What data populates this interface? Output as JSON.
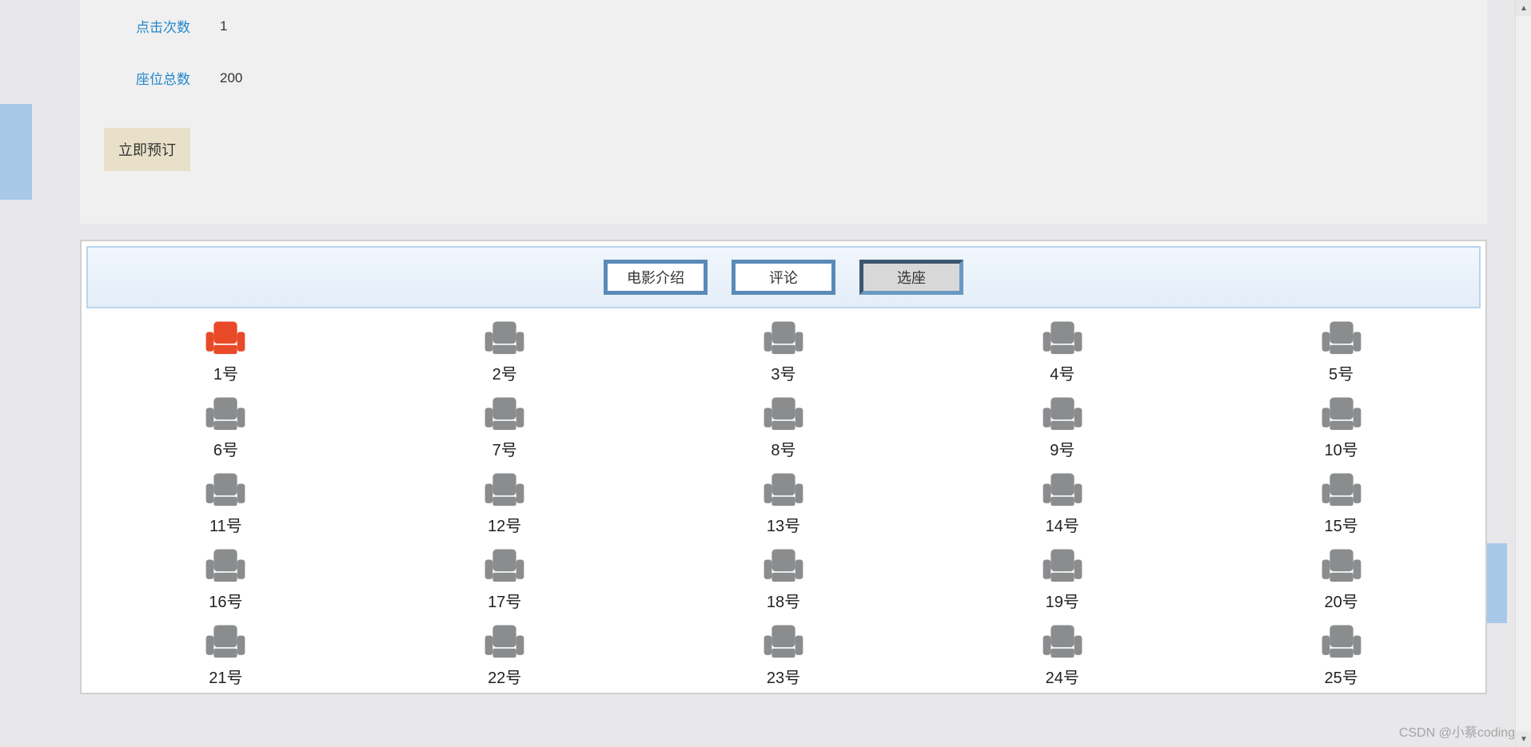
{
  "info": {
    "click_count_label": "点击次数",
    "click_count_value": "1",
    "seat_total_label": "座位总数",
    "seat_total_value": "200"
  },
  "actions": {
    "book_now": "立即预订"
  },
  "tabs": [
    {
      "label": "电影介绍",
      "active": false
    },
    {
      "label": "评论",
      "active": false
    },
    {
      "label": "选座",
      "active": true
    }
  ],
  "seats": {
    "columns": 5,
    "selected_color": "#e84a28",
    "available_color": "#8a8c8e",
    "items": [
      {
        "number": 1,
        "label": "1号",
        "selected": true
      },
      {
        "number": 2,
        "label": "2号",
        "selected": false
      },
      {
        "number": 3,
        "label": "3号",
        "selected": false
      },
      {
        "number": 4,
        "label": "4号",
        "selected": false
      },
      {
        "number": 5,
        "label": "5号",
        "selected": false
      },
      {
        "number": 6,
        "label": "6号",
        "selected": false
      },
      {
        "number": 7,
        "label": "7号",
        "selected": false
      },
      {
        "number": 8,
        "label": "8号",
        "selected": false
      },
      {
        "number": 9,
        "label": "9号",
        "selected": false
      },
      {
        "number": 10,
        "label": "10号",
        "selected": false
      },
      {
        "number": 11,
        "label": "11号",
        "selected": false
      },
      {
        "number": 12,
        "label": "12号",
        "selected": false
      },
      {
        "number": 13,
        "label": "13号",
        "selected": false
      },
      {
        "number": 14,
        "label": "14号",
        "selected": false
      },
      {
        "number": 15,
        "label": "15号",
        "selected": false
      },
      {
        "number": 16,
        "label": "16号",
        "selected": false
      },
      {
        "number": 17,
        "label": "17号",
        "selected": false
      },
      {
        "number": 18,
        "label": "18号",
        "selected": false
      },
      {
        "number": 19,
        "label": "19号",
        "selected": false
      },
      {
        "number": 20,
        "label": "20号",
        "selected": false
      },
      {
        "number": 21,
        "label": "21号",
        "selected": false
      },
      {
        "number": 22,
        "label": "22号",
        "selected": false
      },
      {
        "number": 23,
        "label": "23号",
        "selected": false
      },
      {
        "number": 24,
        "label": "24号",
        "selected": false
      },
      {
        "number": 25,
        "label": "25号",
        "selected": false
      }
    ]
  },
  "watermark": "CSDN @小蔡coding"
}
